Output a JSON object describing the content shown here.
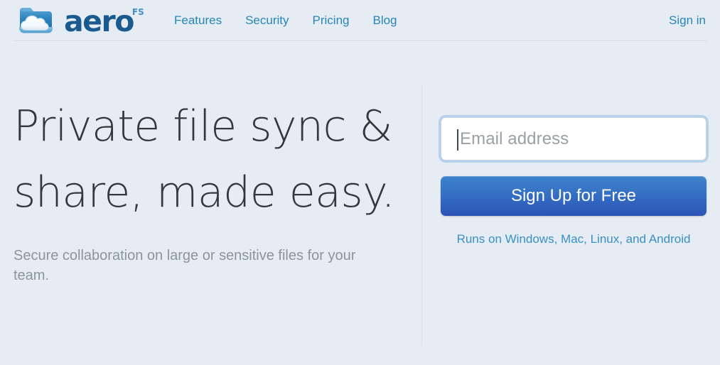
{
  "header": {
    "logo": {
      "icon_name": "folder-cloud-logo-icon",
      "wordmark": "aero",
      "superscript": "FS"
    },
    "nav_items": [
      {
        "label": "Features"
      },
      {
        "label": "Security"
      },
      {
        "label": "Pricing"
      },
      {
        "label": "Blog"
      }
    ],
    "signin_label": "Sign in"
  },
  "hero": {
    "headline": "Private file sync & share, made easy.",
    "subheadline": "Secure collaboration on large or sensitive files for your team."
  },
  "signup": {
    "email_placeholder": "Email address",
    "email_value": "",
    "button_label": "Sign Up for Free",
    "platforms_label": "Runs on Windows, Mac, Linux, and Android"
  },
  "colors": {
    "background": "#e6ecf4",
    "link_blue": "#2886b5",
    "brand_dark_blue": "#1b5a8e",
    "headline_gray": "#33383d",
    "subtext_gray": "#8b949e",
    "button_gradient_top": "#3d84cc",
    "button_gradient_bottom": "#2b53b6",
    "focus_ring": "#7db2e1"
  }
}
